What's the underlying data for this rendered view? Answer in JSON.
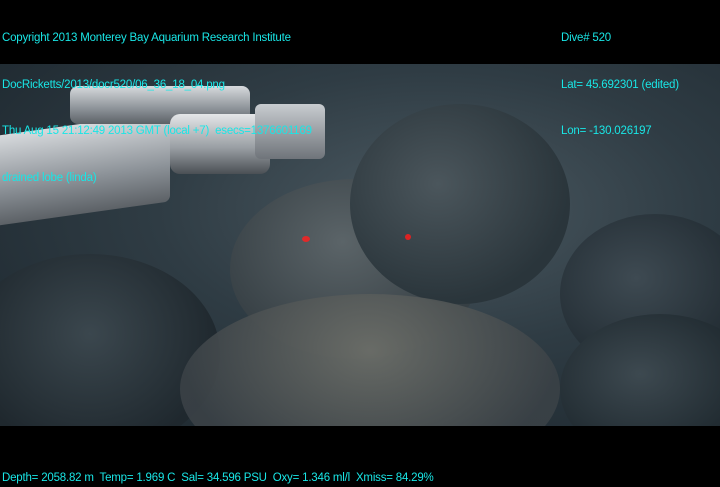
{
  "header_left": {
    "copyright": "Copyright 2013 Monterey Bay Aquarium Research Institute",
    "file_path": "DocRicketts/2013/docr520/06_36_18_04.png",
    "timestamp": "Thu Aug 15 21:12:49 2013 GMT (local +7)  esecs=1376601169",
    "annotation": "drained lobe (linda)"
  },
  "header_right": {
    "dive": "Dive# 520",
    "lat": "Lat= 45.692301 (edited)",
    "lon": "Lon= -130.026197"
  },
  "footer": {
    "sensors": "Depth= 2058.82 m  Temp= 1.969 C  Sal= 34.596 PSU  Oxy= 1.346 ml/l  Xmiss= 84.29%"
  },
  "colors": {
    "overlay_text": "#19e6e6",
    "background": "#000000"
  }
}
